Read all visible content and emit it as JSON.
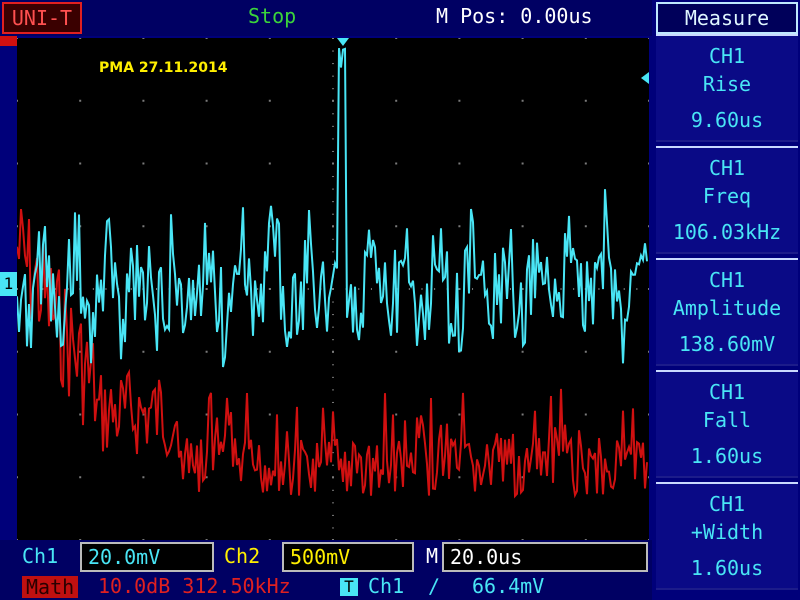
{
  "header": {
    "brand": "UNI-T",
    "run_state": "Stop",
    "m_pos": "M Pos: 0.00us"
  },
  "screen": {
    "watermark": "PMA 27.11.2014",
    "channel_marker": "1"
  },
  "measure": {
    "title": "Measure",
    "items": [
      {
        "channel": "CH1",
        "name": "Rise",
        "value": "9.60us"
      },
      {
        "channel": "CH1",
        "name": "Freq",
        "value": "106.03kHz"
      },
      {
        "channel": "CH1",
        "name": "Amplitude",
        "value": "138.60mV"
      },
      {
        "channel": "CH1",
        "name": "Fall",
        "value": "1.60us"
      },
      {
        "channel": "CH1",
        "name": "+Width",
        "value": "1.60us"
      }
    ]
  },
  "bottom": {
    "ch1_label": "Ch1",
    "ch1_scale": "20.0mV",
    "ch2_label": "Ch2",
    "ch2_scale": "500mV",
    "m_label": "M",
    "m_scale": "20.0us",
    "math_label": "Math",
    "math_settings": "10.0dB 312.50kHz",
    "trigger_tag": "T",
    "trigger_source": "Ch1",
    "trigger_slope": "∕",
    "trigger_level": "66.4mV"
  },
  "colors": {
    "ch1": "#49e5f5",
    "math": "#d01010",
    "ch2": "#ffef00",
    "grid": "#7a7a7a",
    "status": "#3bd43b"
  }
}
